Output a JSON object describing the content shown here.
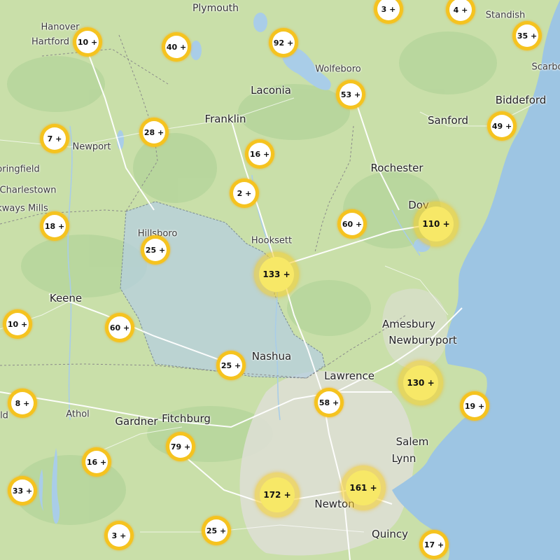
{
  "map": {
    "colors": {
      "land": "#c9dfa9",
      "ocean": "#9dc5e3",
      "lake": "#a9cde8",
      "urban": "#e2e2dc",
      "forest": "#b4d39a",
      "road": "#ffffff",
      "boundary": "#8a8a8a",
      "selection": "#b6cfe0",
      "cluster_ring": "#f5c31f",
      "cluster_large_fill": "#f7e867"
    },
    "places": [
      {
        "id": "plymouth",
        "label": "Plymouth"
      },
      {
        "id": "hanover",
        "label": "Hanover"
      },
      {
        "id": "hartford",
        "label": "Hartford"
      },
      {
        "id": "standish",
        "label": "Standish"
      },
      {
        "id": "scarbo",
        "label": "Scarbo"
      },
      {
        "id": "wolfeboro",
        "label": "Wolfeboro"
      },
      {
        "id": "laconia",
        "label": "Laconia"
      },
      {
        "id": "biddeford",
        "label": "Biddeford"
      },
      {
        "id": "franklin",
        "label": "Franklin"
      },
      {
        "id": "sanford",
        "label": "Sanford"
      },
      {
        "id": "newport",
        "label": "Newport"
      },
      {
        "id": "springfield",
        "label": "oringfield"
      },
      {
        "id": "rochester",
        "label": "Rochester"
      },
      {
        "id": "charlestown",
        "label": "Charlestown"
      },
      {
        "id": "dover",
        "label": "Dov"
      },
      {
        "id": "bellows-falls",
        "label": "kways Mills"
      },
      {
        "id": "hillsboro",
        "label": "Hillsboro"
      },
      {
        "id": "hooksett",
        "label": "Hooksett"
      },
      {
        "id": "keene",
        "label": "Keene"
      },
      {
        "id": "amesbury",
        "label": "Amesbury"
      },
      {
        "id": "newburyport",
        "label": "Newburyport"
      },
      {
        "id": "nashua",
        "label": "Nashua"
      },
      {
        "id": "lawrence",
        "label": "Lawrence"
      },
      {
        "id": "athol",
        "label": "Athol"
      },
      {
        "id": "orange",
        "label": "ld"
      },
      {
        "id": "gardner",
        "label": "Gardner"
      },
      {
        "id": "fitchburg",
        "label": "Fitchburg"
      },
      {
        "id": "salem",
        "label": "Salem"
      },
      {
        "id": "lynn",
        "label": "Lynn"
      },
      {
        "id": "newton",
        "label": "Newton"
      },
      {
        "id": "quincy",
        "label": "Quincy"
      }
    ],
    "clusters": [
      {
        "id": "c1",
        "label": "10 +",
        "size": "small"
      },
      {
        "id": "c2",
        "label": "40 +",
        "size": "small"
      },
      {
        "id": "c3",
        "label": "92 +",
        "size": "small"
      },
      {
        "id": "c4",
        "label": "3 +",
        "size": "small"
      },
      {
        "id": "c5",
        "label": "4 +",
        "size": "small"
      },
      {
        "id": "c6",
        "label": "35 +",
        "size": "small"
      },
      {
        "id": "c7",
        "label": "53 +",
        "size": "small"
      },
      {
        "id": "c8",
        "label": "7 +",
        "size": "small"
      },
      {
        "id": "c9",
        "label": "28 +",
        "size": "small"
      },
      {
        "id": "c10",
        "label": "16 +",
        "size": "small"
      },
      {
        "id": "c11",
        "label": "49 +",
        "size": "small"
      },
      {
        "id": "c12",
        "label": "2 +",
        "size": "small"
      },
      {
        "id": "c13",
        "label": "18 +",
        "size": "small"
      },
      {
        "id": "c14",
        "label": "60 +",
        "size": "small"
      },
      {
        "id": "c15",
        "label": "110 +",
        "size": "large"
      },
      {
        "id": "c16",
        "label": "25 +",
        "size": "small"
      },
      {
        "id": "c17",
        "label": "133 +",
        "size": "large"
      },
      {
        "id": "c18",
        "label": "10 +",
        "size": "small"
      },
      {
        "id": "c19",
        "label": "60 +",
        "size": "small"
      },
      {
        "id": "c20",
        "label": "25 +",
        "size": "small"
      },
      {
        "id": "c21",
        "label": "130 +",
        "size": "large"
      },
      {
        "id": "c22",
        "label": "8 +",
        "size": "small"
      },
      {
        "id": "c23",
        "label": "58 +",
        "size": "small"
      },
      {
        "id": "c24",
        "label": "19 +",
        "size": "small"
      },
      {
        "id": "c25",
        "label": "79 +",
        "size": "small"
      },
      {
        "id": "c26",
        "label": "16 +",
        "size": "small"
      },
      {
        "id": "c27",
        "label": "33 +",
        "size": "small"
      },
      {
        "id": "c28",
        "label": "172 +",
        "size": "large"
      },
      {
        "id": "c29",
        "label": "161 +",
        "size": "large"
      },
      {
        "id": "c30",
        "label": "3 +",
        "size": "small"
      },
      {
        "id": "c31",
        "label": "25 +",
        "size": "small"
      },
      {
        "id": "c32",
        "label": "17 +",
        "size": "small"
      }
    ]
  }
}
